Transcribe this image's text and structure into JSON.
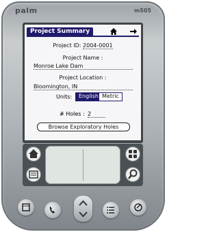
{
  "device": {
    "brand": "palm",
    "model": "m505"
  },
  "screen": {
    "title": "Project Summary",
    "project_id_label": "Project ID:",
    "project_id_value": "2004-0001",
    "project_name_label": "Project Name :",
    "project_name_value": "Monroe Lake Dam",
    "project_location_label": "Project Location :",
    "project_location_value": "Bloomington, IN",
    "units_label": "Units:",
    "units_options": [
      "English",
      "Metric"
    ],
    "units_selected": "English",
    "holes_label": "# Holes :",
    "holes_value": "2",
    "browse_button": "Browse Exploratory Holes"
  },
  "icons": {
    "home": "home-icon",
    "next": "right-arrow-icon",
    "silkscreen": [
      "home-icon",
      "menu-icon",
      "apps-grid-icon",
      "find-icon"
    ],
    "hardware": [
      "date-book-icon",
      "phone-book-icon",
      "todo-icon",
      "note-pad-icon"
    ]
  },
  "colors": {
    "accent": "#1f1a6b"
  }
}
